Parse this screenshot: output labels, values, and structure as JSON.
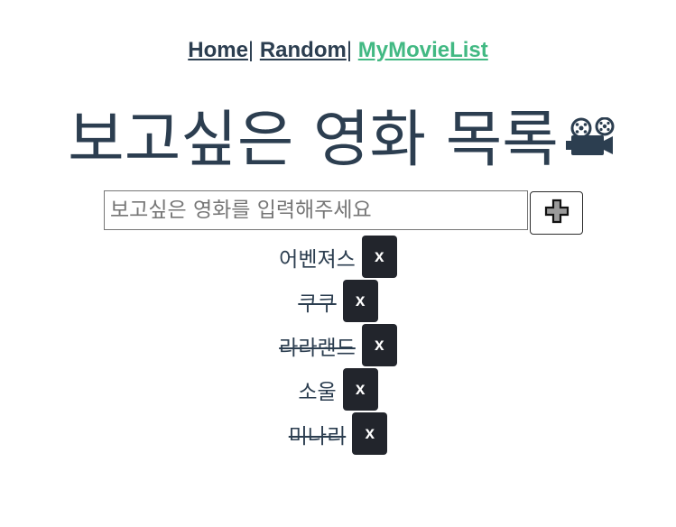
{
  "nav": {
    "items": [
      {
        "label": "Home"
      },
      {
        "label": "Random"
      },
      {
        "label": "MyMovieList"
      }
    ],
    "separator": "|",
    "active_color": "#42b983",
    "text_color": "#2c3e50"
  },
  "header": {
    "title": "보고싶은 영화 목록",
    "icon": "movie-projector-icon"
  },
  "input": {
    "placeholder": "보고싶은 영화를 입력해주세요",
    "value": "",
    "add_icon": "plus-icon"
  },
  "movies": [
    {
      "title": "어벤져스",
      "done": false,
      "delete_label": "x"
    },
    {
      "title": "쿠쿠",
      "done": true,
      "delete_label": "x"
    },
    {
      "title": "라라랜드",
      "done": true,
      "delete_label": "x"
    },
    {
      "title": "소울",
      "done": false,
      "delete_label": "x"
    },
    {
      "title": "미나리",
      "done": true,
      "delete_label": "x"
    }
  ],
  "colors": {
    "delete_button_bg": "#22252c",
    "text": "#2c3e50"
  }
}
